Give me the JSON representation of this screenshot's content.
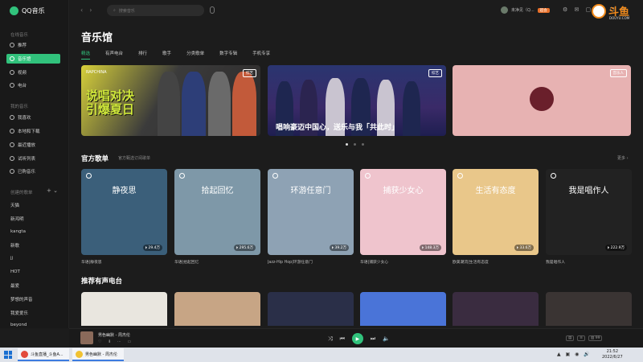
{
  "app": {
    "logo_text": "QQ音乐"
  },
  "sidebar": {
    "section_online": "在线音乐",
    "online_items": [
      {
        "label": "推荐",
        "icon": "recommend-icon"
      },
      {
        "label": "音乐馆",
        "icon": "music-hall-icon"
      },
      {
        "label": "视频",
        "icon": "video-icon"
      },
      {
        "label": "电台",
        "icon": "radio-icon"
      }
    ],
    "section_mine": "我的音乐",
    "mine_items": [
      {
        "label": "我喜欢",
        "icon": "heart-icon"
      },
      {
        "label": "本地和下载",
        "icon": "download-icon"
      },
      {
        "label": "最近播放",
        "icon": "history-icon"
      },
      {
        "label": "试听列表",
        "icon": "list-icon"
      },
      {
        "label": "已购音乐",
        "icon": "purchase-icon"
      }
    ],
    "section_created": "创建的歌单",
    "playlists": [
      "天猫",
      "新鸿明",
      "kangta",
      "新歌",
      "jj",
      "HOT",
      "最爱",
      "梦想的声音",
      "我爱爱乐",
      "beyond"
    ]
  },
  "topbar": {
    "search_placeholder": "搜索音乐",
    "user_name": "未净见（Q...",
    "vip_badge": "超会"
  },
  "watermark": {
    "brand": "斗鱼",
    "url": "DOUYU.COM"
  },
  "main": {
    "title": "音乐馆",
    "tabs": [
      "精选",
      "有声电台",
      "排行",
      "歌手",
      "分类歌单",
      "数字专辑",
      "手机专享"
    ],
    "banners": [
      {
        "headline_1": "说唱对决",
        "headline_2": "引爆夏日",
        "top_text": "RAPCHINA",
        "tag": "综艺"
      },
      {
        "slogan": "唱响豪迈中国心，送乐与我「共此时」",
        "tag": "综艺"
      },
      {
        "tag": "音乐人"
      }
    ],
    "official_title": "官方歌单",
    "official_sub": "官方甄选订阅歌单",
    "more_label": "更多 ›",
    "cards": [
      {
        "cover_text": "静夜思",
        "plays": "29.4万",
        "caption": "华语|静夜思",
        "bg": "#3b5f7a"
      },
      {
        "cover_text": "拾起回忆",
        "plays": "295.6万",
        "caption": "华语|拾起回忆",
        "bg": "#7e98a8"
      },
      {
        "cover_text": "环游任意门",
        "plays": "39.2万",
        "caption": "Jazz-Hip Hop|环游任意门",
        "bg": "#8ea2b4"
      },
      {
        "cover_text": "捕获少女心",
        "plays": "148.3万",
        "caption": "华语|捕获少女心",
        "bg": "#efc4cd"
      },
      {
        "cover_text": "生活有态度",
        "plays": "33.6万",
        "caption": "欧美潮流|生活有态度",
        "bg": "#e9c78a"
      },
      {
        "cover_text": "我是唱作人",
        "plays": "222.9万",
        "caption": "我是唱作人",
        "bg": "#222222"
      }
    ],
    "radio_title": "推荐有声电台",
    "radio_cards": [
      {
        "bg": "#e9e6df"
      },
      {
        "bg": "#c7a585"
      },
      {
        "bg": "#2a2f48"
      },
      {
        "bg": "#4a74d8"
      },
      {
        "bg": "#3a2c40"
      },
      {
        "bg": "#3a3433"
      }
    ]
  },
  "player": {
    "title": "男色幽默 - 周杰伦"
  },
  "taskbar": {
    "tasks": [
      {
        "label": "斗鱼直播_斗鱼A...",
        "color": "#e24b3c"
      },
      {
        "label": "男色幽默 - 周杰伦",
        "color": "#f1c232"
      }
    ],
    "time": "21:52",
    "date": "2022/6/27"
  },
  "colors": {
    "accent": "#31c27c",
    "bg": "#1c1c1c"
  }
}
